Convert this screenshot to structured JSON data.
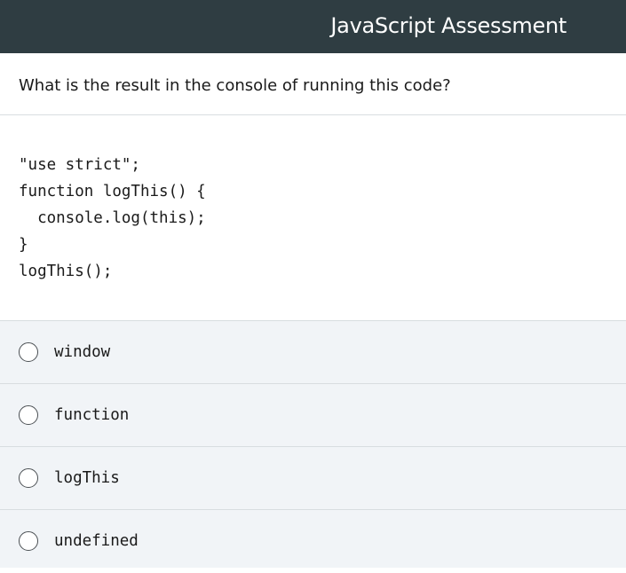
{
  "header": {
    "title": "JavaScript Assessment"
  },
  "question": {
    "text": "What is the result in the console of running this code?"
  },
  "code": {
    "lines": [
      "\"use strict\";",
      "function logThis() {",
      "  console.log(this);",
      "}",
      "logThis();"
    ]
  },
  "options": [
    {
      "label": "window",
      "selected": false
    },
    {
      "label": "function",
      "selected": false
    },
    {
      "label": "logThis",
      "selected": false
    },
    {
      "label": "undefined",
      "selected": false
    }
  ],
  "colors": {
    "header_bg": "#2f3d42",
    "options_bg": "#f1f4f7"
  }
}
